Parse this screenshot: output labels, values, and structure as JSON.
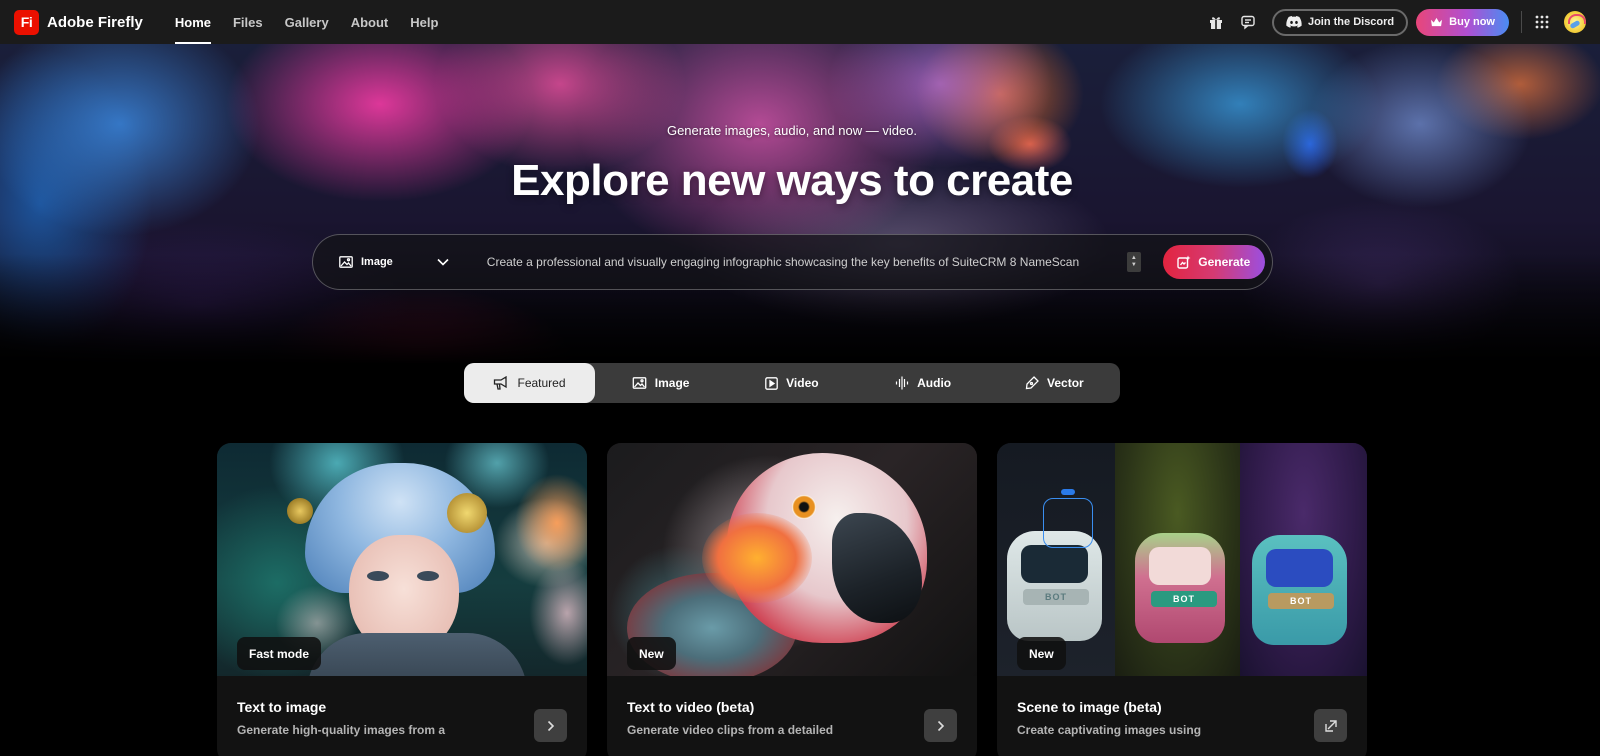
{
  "app": {
    "logo_text": "Fi",
    "name": "Adobe Firefly"
  },
  "nav": {
    "links": [
      {
        "label": "Home",
        "active": true
      },
      {
        "label": "Files",
        "active": false
      },
      {
        "label": "Gallery",
        "active": false
      },
      {
        "label": "About",
        "active": false
      },
      {
        "label": "Help",
        "active": false
      }
    ],
    "icons": [
      "gift-icon",
      "feedback-icon"
    ],
    "discord_label": "Join the Discord",
    "buy_label": "Buy now",
    "apps_icon": "apps-grid-icon",
    "avatar": "user-avatar"
  },
  "hero": {
    "subtitle": "Generate images, audio, and now — video.",
    "title": "Explore new ways to create",
    "prompt": {
      "type_label": "Image",
      "value": "Create a professional and visually engaging infographic showcasing the key benefits of SuiteCRM 8 NameScan",
      "generate_label": "Generate"
    }
  },
  "categories": [
    {
      "label": "Featured",
      "icon": "megaphone-icon",
      "active": true
    },
    {
      "label": "Image",
      "icon": "image-icon",
      "active": false
    },
    {
      "label": "Video",
      "icon": "video-icon",
      "active": false
    },
    {
      "label": "Audio",
      "icon": "audio-waveform-icon",
      "active": false
    },
    {
      "label": "Vector",
      "icon": "pen-icon",
      "active": false
    }
  ],
  "cards": [
    {
      "badge": "Fast mode",
      "title": "Text to image",
      "description": "Generate high-quality images from a",
      "action_icon": "chevron-right-icon"
    },
    {
      "badge": "New",
      "title": "Text to video (beta)",
      "description": "Generate video clips from a detailed",
      "action_icon": "chevron-right-icon"
    },
    {
      "badge": "New",
      "title": "Scene to image (beta)",
      "description": "Create captivating images using",
      "action_icon": "open-external-icon"
    }
  ],
  "colors": {
    "brand_red": "#eb1000",
    "nav_bg": "#1b1b1b",
    "generate_gradient_start": "#e3243f",
    "generate_gradient_end": "#9b4fe0",
    "buy_gradient_start": "#e8467a",
    "buy_gradient_end": "#4a8cf2",
    "tabs_bg": "#3b3b3b",
    "tab_active_bg": "#ececec",
    "card_bg": "#121212"
  }
}
